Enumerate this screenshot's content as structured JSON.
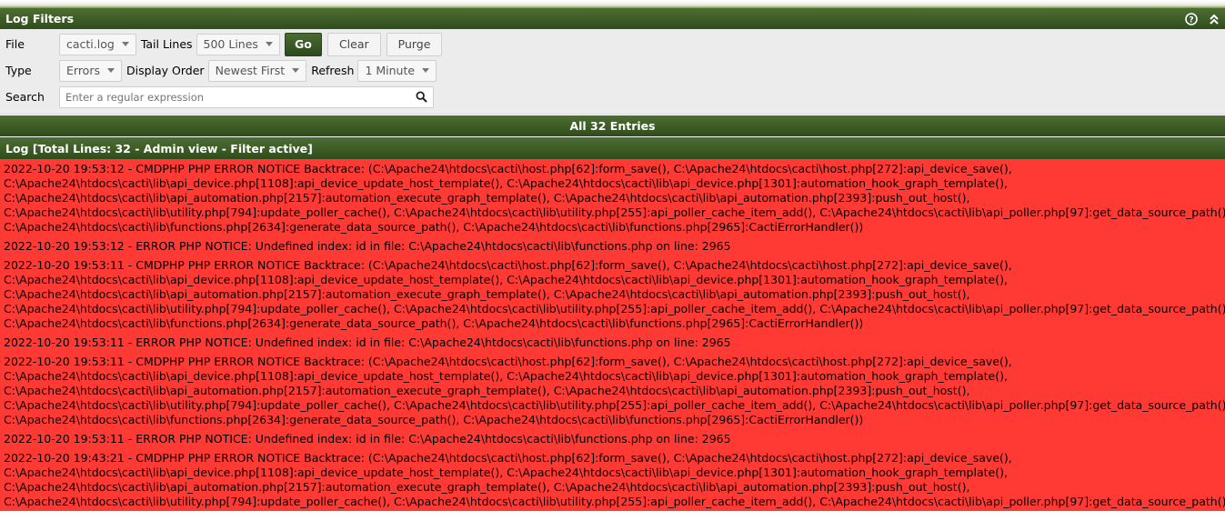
{
  "filters": {
    "title": "Log Filters",
    "file_label": "File",
    "file_value": "cacti.log",
    "tail_label": "Tail Lines",
    "tail_value": "500 Lines",
    "go_label": "Go",
    "clear_label": "Clear",
    "purge_label": "Purge",
    "type_label": "Type",
    "type_value": "Errors",
    "order_label": "Display Order",
    "order_value": "Newest First",
    "refresh_label": "Refresh",
    "refresh_value": "1 Minute",
    "search_label": "Search",
    "search_placeholder": "Enter a regular expression"
  },
  "entries_title": "All 32 Entries",
  "log_title": "Log [Total Lines: 32 - Admin view - Filter active]",
  "colors": {
    "header_green": "#3d5d27",
    "error_red": "#ff3a34"
  },
  "log_entries": [
    "2022-10-20 19:53:12 - CMDPHP PHP ERROR NOTICE Backtrace: (C:\\Apache24\\htdocs\\cacti\\host.php[62]:form_save(), C:\\Apache24\\htdocs\\cacti\\host.php[272]:api_device_save(),\nC:\\Apache24\\htdocs\\cacti\\lib\\api_device.php[1108]:api_device_update_host_template(), C:\\Apache24\\htdocs\\cacti\\lib\\api_device.php[1301]:automation_hook_graph_template(),\nC:\\Apache24\\htdocs\\cacti\\lib\\api_automation.php[2157]:automation_execute_graph_template(), C:\\Apache24\\htdocs\\cacti\\lib\\api_automation.php[2393]:push_out_host(),\nC:\\Apache24\\htdocs\\cacti\\lib\\utility.php[794]:update_poller_cache(), C:\\Apache24\\htdocs\\cacti\\lib\\utility.php[255]:api_poller_cache_item_add(), C:\\Apache24\\htdocs\\cacti\\lib\\api_poller.php[97]:get_data_source_path(),\nC:\\Apache24\\htdocs\\cacti\\lib\\functions.php[2634]:generate_data_source_path(), C:\\Apache24\\htdocs\\cacti\\lib\\functions.php[2965]:CactiErrorHandler())",
    "2022-10-20 19:53:12 - ERROR PHP NOTICE: Undefined index: id in file: C:\\Apache24\\htdocs\\cacti\\lib\\functions.php on line: 2965",
    "2022-10-20 19:53:11 - CMDPHP PHP ERROR NOTICE Backtrace: (C:\\Apache24\\htdocs\\cacti\\host.php[62]:form_save(), C:\\Apache24\\htdocs\\cacti\\host.php[272]:api_device_save(),\nC:\\Apache24\\htdocs\\cacti\\lib\\api_device.php[1108]:api_device_update_host_template(), C:\\Apache24\\htdocs\\cacti\\lib\\api_device.php[1301]:automation_hook_graph_template(),\nC:\\Apache24\\htdocs\\cacti\\lib\\api_automation.php[2157]:automation_execute_graph_template(), C:\\Apache24\\htdocs\\cacti\\lib\\api_automation.php[2393]:push_out_host(),\nC:\\Apache24\\htdocs\\cacti\\lib\\utility.php[794]:update_poller_cache(), C:\\Apache24\\htdocs\\cacti\\lib\\utility.php[255]:api_poller_cache_item_add(), C:\\Apache24\\htdocs\\cacti\\lib\\api_poller.php[97]:get_data_source_path(),\nC:\\Apache24\\htdocs\\cacti\\lib\\functions.php[2634]:generate_data_source_path(), C:\\Apache24\\htdocs\\cacti\\lib\\functions.php[2965]:CactiErrorHandler())",
    "2022-10-20 19:53:11 - ERROR PHP NOTICE: Undefined index: id in file: C:\\Apache24\\htdocs\\cacti\\lib\\functions.php on line: 2965",
    "2022-10-20 19:53:11 - CMDPHP PHP ERROR NOTICE Backtrace: (C:\\Apache24\\htdocs\\cacti\\host.php[62]:form_save(), C:\\Apache24\\htdocs\\cacti\\host.php[272]:api_device_save(),\nC:\\Apache24\\htdocs\\cacti\\lib\\api_device.php[1108]:api_device_update_host_template(), C:\\Apache24\\htdocs\\cacti\\lib\\api_device.php[1301]:automation_hook_graph_template(),\nC:\\Apache24\\htdocs\\cacti\\lib\\api_automation.php[2157]:automation_execute_graph_template(), C:\\Apache24\\htdocs\\cacti\\lib\\api_automation.php[2393]:push_out_host(),\nC:\\Apache24\\htdocs\\cacti\\lib\\utility.php[794]:update_poller_cache(), C:\\Apache24\\htdocs\\cacti\\lib\\utility.php[255]:api_poller_cache_item_add(), C:\\Apache24\\htdocs\\cacti\\lib\\api_poller.php[97]:get_data_source_path(),\nC:\\Apache24\\htdocs\\cacti\\lib\\functions.php[2634]:generate_data_source_path(), C:\\Apache24\\htdocs\\cacti\\lib\\functions.php[2965]:CactiErrorHandler())",
    "2022-10-20 19:53:11 - ERROR PHP NOTICE: Undefined index: id in file: C:\\Apache24\\htdocs\\cacti\\lib\\functions.php on line: 2965",
    "2022-10-20 19:43:21 - CMDPHP PHP ERROR NOTICE Backtrace: (C:\\Apache24\\htdocs\\cacti\\host.php[62]:form_save(), C:\\Apache24\\htdocs\\cacti\\host.php[272]:api_device_save(),\nC:\\Apache24\\htdocs\\cacti\\lib\\api_device.php[1108]:api_device_update_host_template(), C:\\Apache24\\htdocs\\cacti\\lib\\api_device.php[1301]:automation_hook_graph_template(),\nC:\\Apache24\\htdocs\\cacti\\lib\\api_automation.php[2157]:automation_execute_graph_template(), C:\\Apache24\\htdocs\\cacti\\lib\\api_automation.php[2393]:push_out_host(),\nC:\\Apache24\\htdocs\\cacti\\lib\\utility.php[794]:update_poller_cache(), C:\\Apache24\\htdocs\\cacti\\lib\\utility.php[255]:api_poller_cache_item_add(), C:\\Apache24\\htdocs\\cacti\\lib\\api_poller.php[97]:get_data_source_path(),"
  ]
}
